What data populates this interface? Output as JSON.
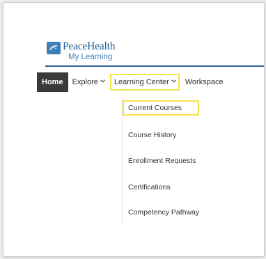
{
  "logo": {
    "brand": "PeaceHealth",
    "subtitle": "My Learning",
    "icon": "peacehealth-logo-icon"
  },
  "nav": {
    "items": [
      {
        "label": "Home",
        "dropdown": false
      },
      {
        "label": "Explore",
        "dropdown": true
      },
      {
        "label": "Learning Center",
        "dropdown": true
      },
      {
        "label": "Workspace",
        "dropdown": false
      }
    ]
  },
  "dropdown": {
    "items": [
      {
        "label": "Current Courses"
      },
      {
        "label": "Course History"
      },
      {
        "label": "Enrollment Requests"
      },
      {
        "label": "Certifications"
      },
      {
        "label": "Competency Pathway"
      }
    ]
  },
  "colors": {
    "brand_blue": "#1f5f9a",
    "highlight_yellow": "#f2e24a",
    "home_bg": "#3a3a3a"
  }
}
